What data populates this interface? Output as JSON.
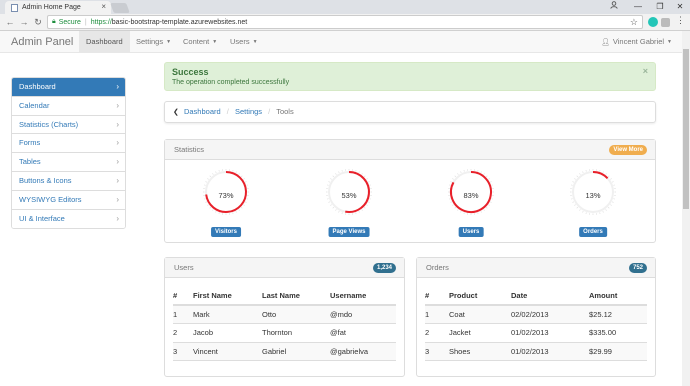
{
  "browser": {
    "tab_title": "Admin Home Page",
    "tab_close": "×",
    "secure_label": "Secure",
    "url_scheme": "https://",
    "url_rest": "basic-bootstrap-template.azurewebsites.net",
    "win_min": "—",
    "win_max": "❐",
    "win_close": "✕",
    "profile_icon": "person-icon"
  },
  "navbar": {
    "brand": "Admin Panel",
    "items": [
      {
        "label": "Dashboard"
      },
      {
        "label": "Settings"
      },
      {
        "label": "Content"
      },
      {
        "label": "Users"
      }
    ],
    "user": "Vincent Gabriel"
  },
  "sidebar": {
    "items": [
      {
        "label": "Dashboard"
      },
      {
        "label": "Calendar"
      },
      {
        "label": "Statistics (Charts)"
      },
      {
        "label": "Forms"
      },
      {
        "label": "Tables"
      },
      {
        "label": "Buttons & Icons"
      },
      {
        "label": "WYSIWYG Editors"
      },
      {
        "label": "UI & Interface"
      }
    ]
  },
  "alert": {
    "title": "Success",
    "text": "The operation completed successfully",
    "close": "×"
  },
  "breadcrumb": {
    "items": [
      "Dashboard",
      "Settings",
      "Tools"
    ]
  },
  "stats": {
    "title": "Statistics",
    "button": "View More",
    "items": [
      {
        "value": "73%",
        "label": "Visitors",
        "pct": 73
      },
      {
        "value": "53%",
        "label": "Page Views",
        "pct": 53
      },
      {
        "value": "83%",
        "label": "Users",
        "pct": 83
      },
      {
        "value": "13%",
        "label": "Orders",
        "pct": 13
      }
    ],
    "ring_color": "#e8202a"
  },
  "users": {
    "title": "Users",
    "badge": "1,234",
    "headers": [
      "#",
      "First Name",
      "Last Name",
      "Username"
    ],
    "rows": [
      [
        "1",
        "Mark",
        "Otto",
        "@mdo"
      ],
      [
        "2",
        "Jacob",
        "Thornton",
        "@fat"
      ],
      [
        "3",
        "Vincent",
        "Gabriel",
        "@gabrielva"
      ]
    ]
  },
  "orders": {
    "title": "Orders",
    "badge": "752",
    "headers": [
      "#",
      "Product",
      "Date",
      "Amount"
    ],
    "rows": [
      [
        "1",
        "Coat",
        "02/02/2013",
        "$25.12"
      ],
      [
        "2",
        "Jacket",
        "01/02/2013",
        "$335.00"
      ],
      [
        "3",
        "Shoes",
        "01/02/2013",
        "$29.99"
      ]
    ]
  }
}
